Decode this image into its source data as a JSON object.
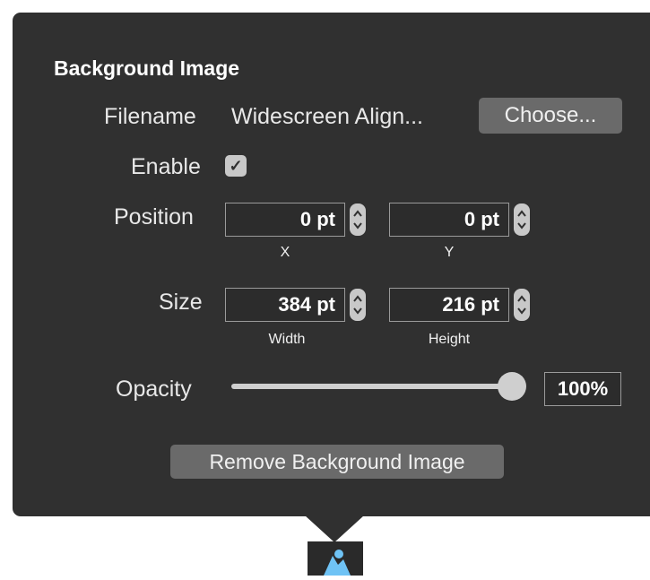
{
  "panel": {
    "title": "Background Image",
    "filename_label": "Filename",
    "filename_value": "Widescreen Align...",
    "choose_button": "Choose...",
    "enable_label": "Enable",
    "enable_checked": true,
    "checkmark": "✓",
    "position_label": "Position",
    "position_x": "0 pt",
    "position_y": "0 pt",
    "x_label": "X",
    "y_label": "Y",
    "size_label": "Size",
    "size_width": "384 pt",
    "size_height": "216 pt",
    "width_label": "Width",
    "height_label": "Height",
    "opacity_label": "Opacity",
    "opacity_value": "100%",
    "opacity_level": 1.0,
    "remove_button": "Remove Background Image"
  }
}
